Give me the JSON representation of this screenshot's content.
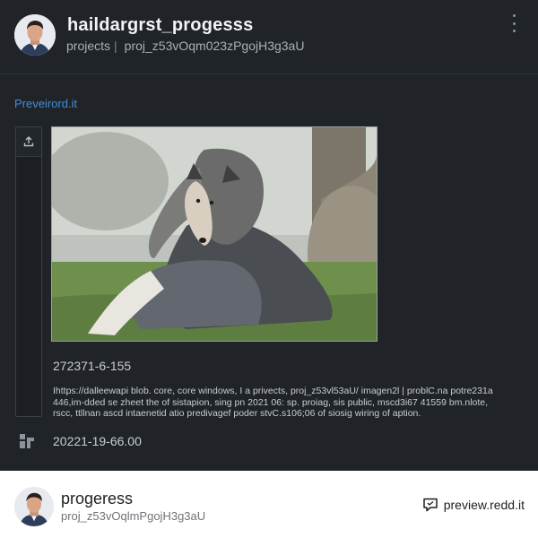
{
  "header": {
    "title": "haildargrst_progesss",
    "breadcrumb_project": "projects",
    "breadcrumb_separator": "|",
    "project_id": "proj_z53vOqm023zPgojH3g3aU"
  },
  "content": {
    "preview_link": "Preveirord.it",
    "image_id": "272371-6-155",
    "image_url_text": "Ihttps://dalleewapi blob. core, core windows, I a privects, proj_z53vl53aU/ imagen2l | problC.na potre231a 446,im-dded se zheet the of sistapion, sing pn 2021 06: sp. proiag, sis public, mscd3i67 41559 bm.nlote, rscc, ttllnan ascd intaenetid atio predivagef poder stvC.s106;06 of siosig wiring of aption.",
    "date": "20221-19-66.00",
    "photo_alt_icon": "dog-photo"
  },
  "footer": {
    "title": "progeress",
    "subtitle": "proj_z53vOqlmPgojH3g3aU",
    "link_text": "preview.redd.it",
    "link_icon": "chat-bubble-icon"
  }
}
